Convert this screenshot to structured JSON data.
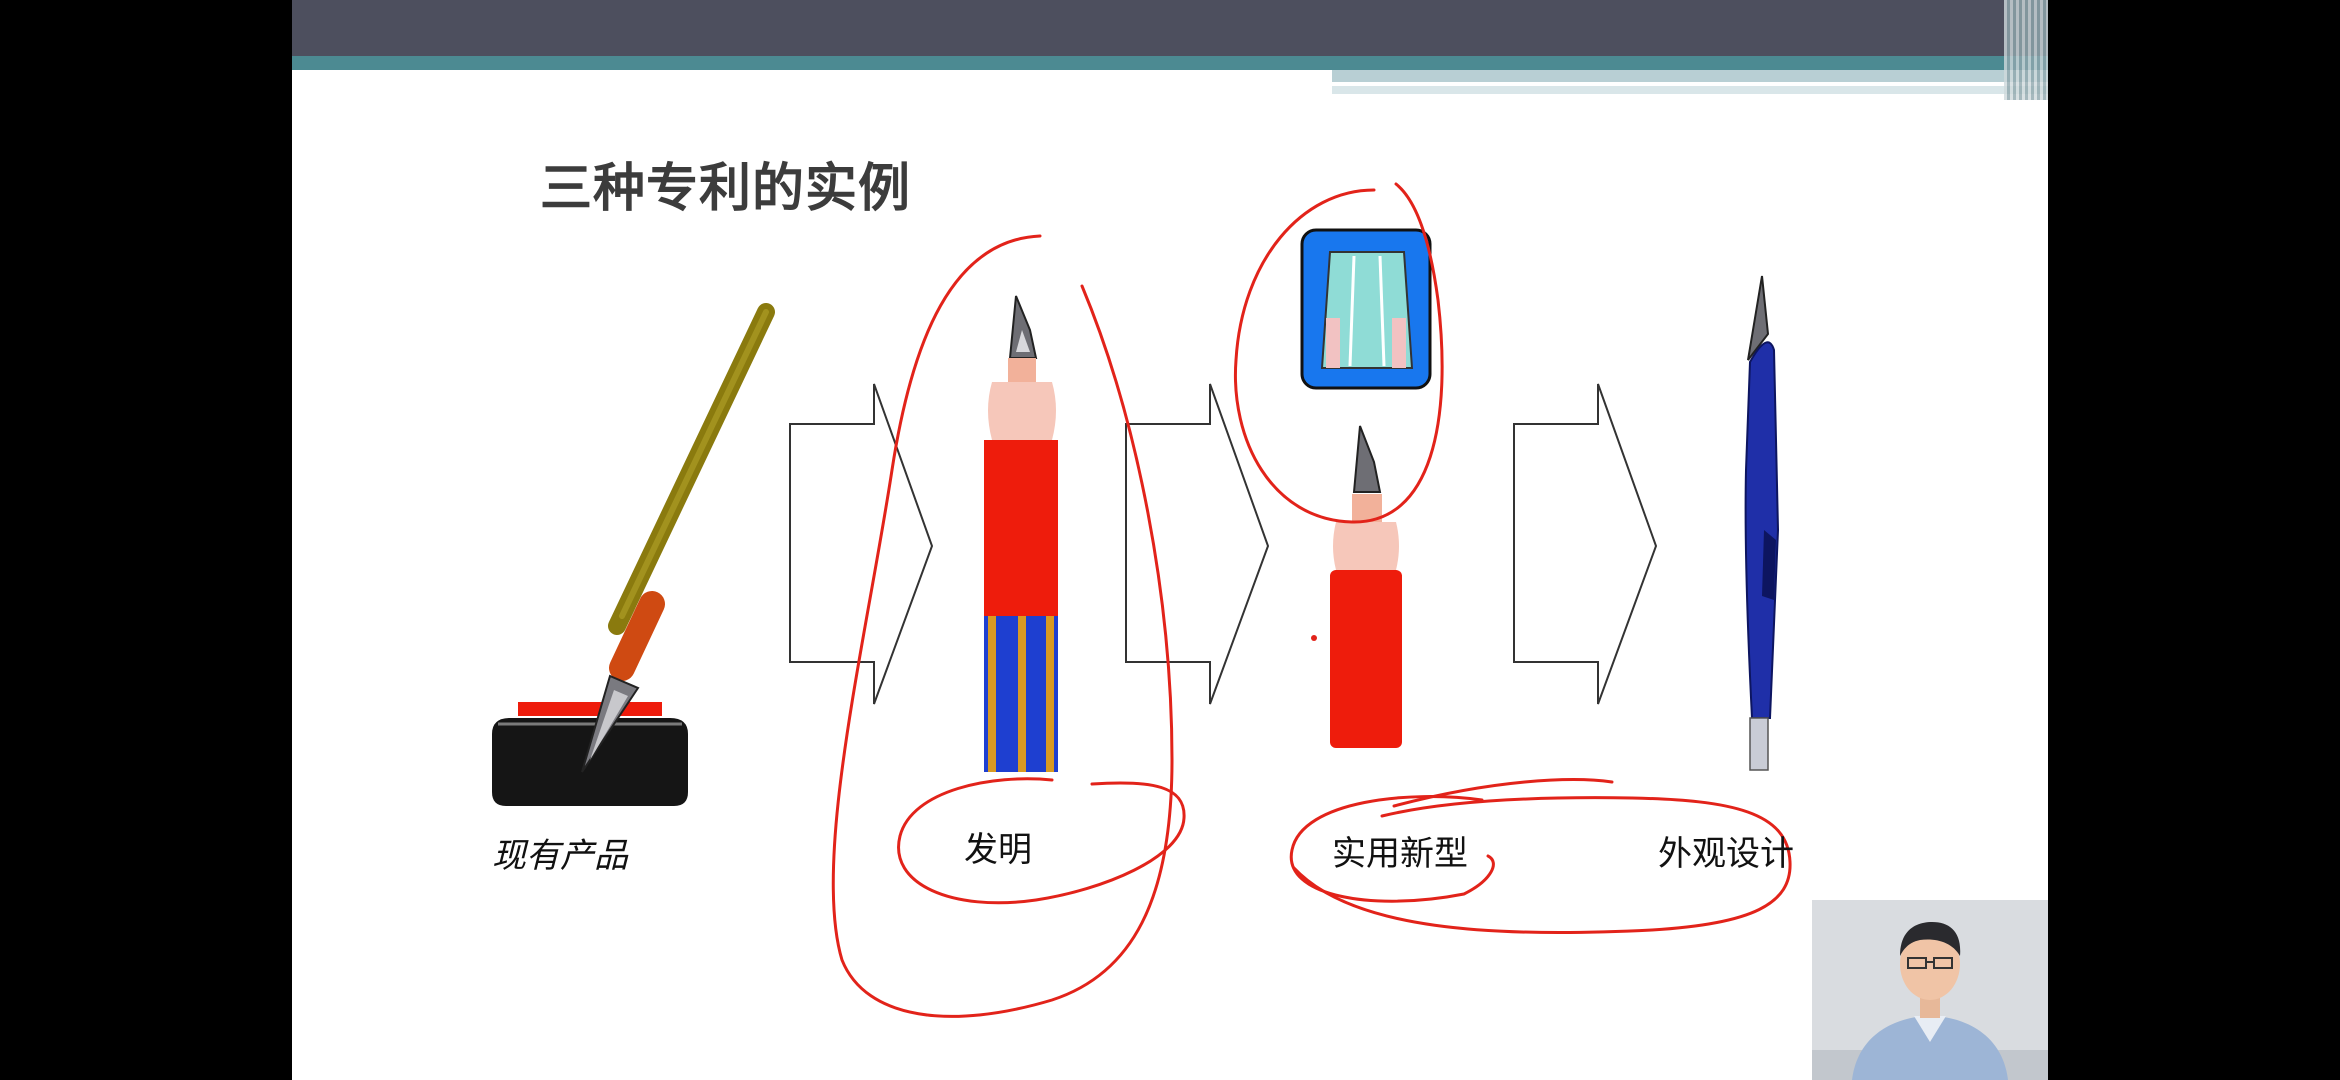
{
  "slide": {
    "title": "三种专利的实例",
    "labels": {
      "existing": "现有产品",
      "invention": "发明",
      "utility": "实用新型",
      "design": "外观设计"
    }
  },
  "colors": {
    "header_dark": "#4d4f5e",
    "header_teal": "#4c8a92",
    "annotation_red": "#e2231a",
    "pen_red": "#ee1c0c",
    "pen_blue": "#1f2fa8",
    "inset_blue": "#1877ee"
  },
  "icons": [
    "dip-pen-with-inkwell-icon",
    "fountain-pen-red-blue-icon",
    "pen-cap-detail-icon",
    "fountain-pen-red-icon",
    "fountain-pen-blue-icon",
    "hollow-arrow-icon"
  ]
}
